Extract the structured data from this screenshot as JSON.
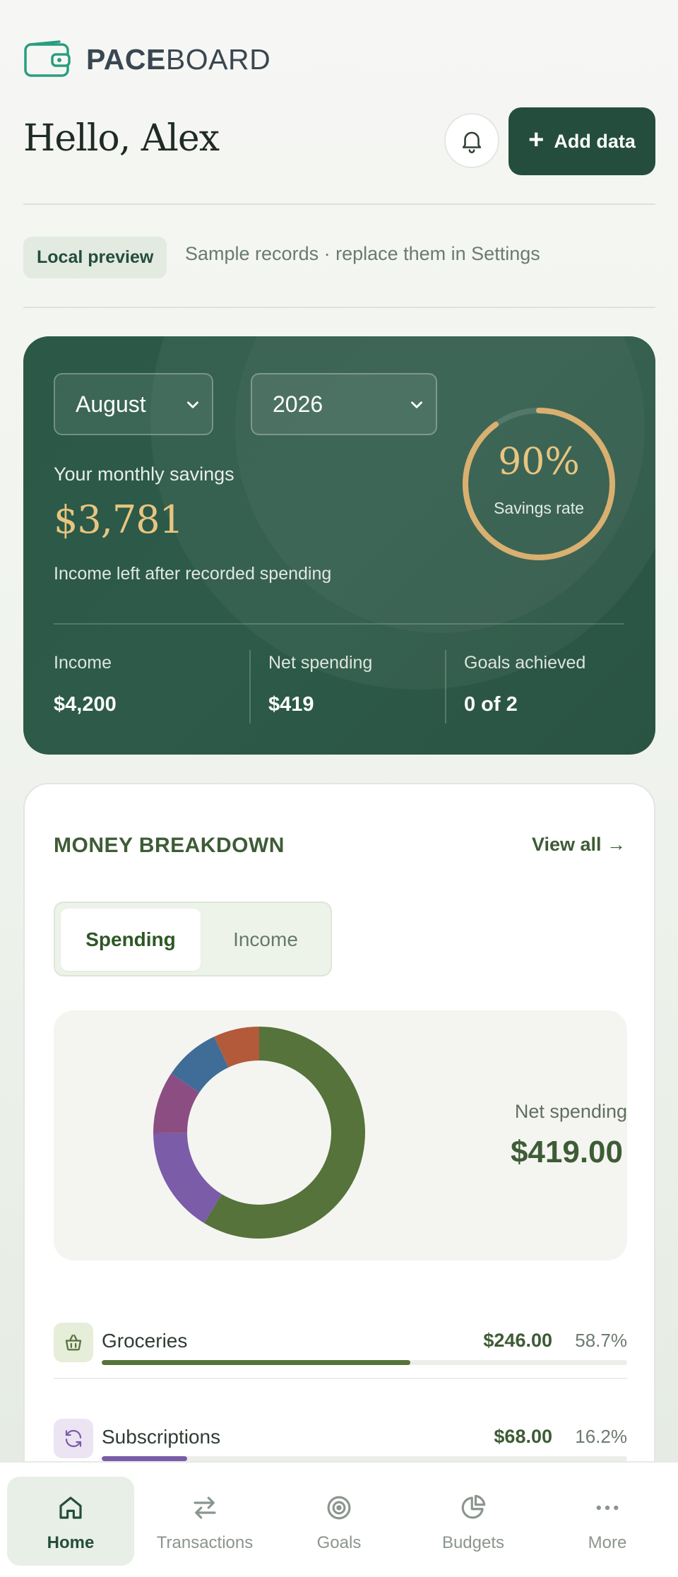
{
  "brand": {
    "name_bold": "PACE",
    "name_light": "BOARD",
    "icon": "wallet-icon",
    "icon_color": "#2a9d80"
  },
  "header": {
    "greeting": "Hello, Alex",
    "notification_icon": "bell-icon",
    "add_button_label": "Add data"
  },
  "preview": {
    "badge": "Local preview",
    "note": "Sample records · replace them in Settings"
  },
  "hero": {
    "month": "August",
    "year": "2026",
    "savings_label": "Your monthly savings",
    "savings_value": "$3,781",
    "savings_note": "Income left after recorded spending",
    "savings_rate_value": "90%",
    "savings_rate_fraction": 0.9,
    "savings_rate_label": "Savings rate",
    "stats": [
      {
        "label": "Income",
        "value": "$4,200"
      },
      {
        "label": "Net spending",
        "value": "$419"
      },
      {
        "label": "Goals achieved",
        "value": "0 of 2"
      }
    ]
  },
  "breakdown": {
    "title": "MONEY BREAKDOWN",
    "view_all": "View all →",
    "tabs": [
      {
        "label": "Spending",
        "active": true
      },
      {
        "label": "Income",
        "active": false
      }
    ],
    "chart_label": "Net spending",
    "chart_total": "$419.00",
    "categories": [
      {
        "name": "Groceries",
        "amount": "$246.00",
        "percent": "58.7%",
        "share": 0.587,
        "color": "#55733a",
        "icon": "basket-icon",
        "icon_bg": "#e6edd9"
      },
      {
        "name": "Subscriptions",
        "amount": "$68.00",
        "percent": "16.2%",
        "share": 0.162,
        "color": "#7a5ca8",
        "icon": "refresh-icon",
        "icon_bg": "#ece4f3"
      }
    ]
  },
  "chart_data": {
    "type": "pie",
    "categories": [
      "Groceries",
      "Subscriptions",
      "",
      "",
      ""
    ],
    "values": [
      58.7,
      16.2,
      9.5,
      8.6,
      7.0
    ],
    "colors": [
      "#55733a",
      "#7a5ca8",
      "#8c4e82",
      "#3f6d98",
      "#b25a3a"
    ]
  },
  "nav": [
    {
      "label": "Home",
      "icon": "home-icon",
      "active": true
    },
    {
      "label": "Transactions",
      "icon": "swap-arrows-icon",
      "active": false
    },
    {
      "label": "Goals",
      "icon": "target-icon",
      "active": false
    },
    {
      "label": "Budgets",
      "icon": "pie-chart-icon",
      "active": false
    },
    {
      "label": "More",
      "icon": "more-dots-icon",
      "active": false
    }
  ]
}
